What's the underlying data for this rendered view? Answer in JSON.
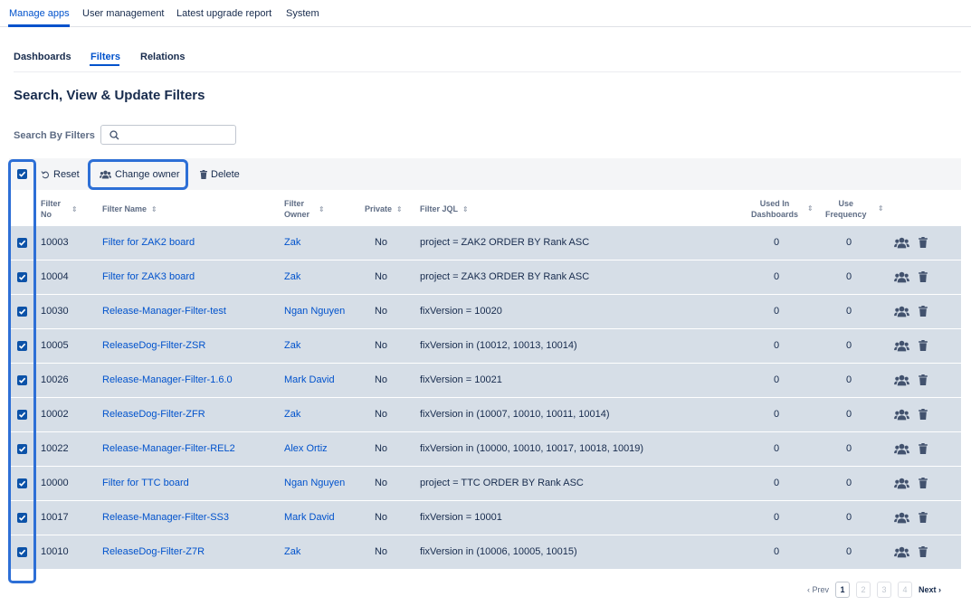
{
  "topnav": {
    "items": [
      "Manage apps",
      "User management",
      "Latest upgrade report",
      "System"
    ],
    "active": "Manage apps"
  },
  "subtabs": {
    "items": [
      "Dashboards",
      "Filters",
      "Relations"
    ],
    "active": "Filters"
  },
  "page_title": "Search, View & Update Filters",
  "search": {
    "label": "Search By Filters",
    "value": "",
    "icon": "search-icon"
  },
  "toolbar": {
    "select_all_checked": true,
    "reset_label": "Reset",
    "change_owner_label": "Change owner",
    "delete_label": "Delete"
  },
  "table": {
    "headers": {
      "filter_no": [
        "Filter",
        "No"
      ],
      "filter_name": "Filter Name",
      "filter_owner": [
        "Filter",
        "Owner"
      ],
      "private": "Private",
      "filter_jql": "Filter JQL",
      "used_in_dashboards": [
        "Used In",
        "Dashboards"
      ],
      "use_frequency": [
        "Use",
        "Frequency"
      ]
    },
    "rows": [
      {
        "no": "10003",
        "name": "Filter for ZAK2 board",
        "owner": "Zak",
        "private": "No",
        "jql": "project = ZAK2 ORDER BY Rank ASC",
        "used": "0",
        "freq": "0"
      },
      {
        "no": "10004",
        "name": "Filter for ZAK3 board",
        "owner": "Zak",
        "private": "No",
        "jql": "project = ZAK3 ORDER BY Rank ASC",
        "used": "0",
        "freq": "0"
      },
      {
        "no": "10030",
        "name": "Release-Manager-Filter-test",
        "owner": "Ngan Nguyen",
        "private": "No",
        "jql": "fixVersion = 10020",
        "used": "0",
        "freq": "0"
      },
      {
        "no": "10005",
        "name": "ReleaseDog-Filter-ZSR",
        "owner": "Zak",
        "private": "No",
        "jql": "fixVersion in (10012, 10013, 10014)",
        "used": "0",
        "freq": "0"
      },
      {
        "no": "10026",
        "name": "Release-Manager-Filter-1.6.0",
        "owner": "Mark David",
        "private": "No",
        "jql": "fixVersion = 10021",
        "used": "0",
        "freq": "0"
      },
      {
        "no": "10002",
        "name": "ReleaseDog-Filter-ZFR",
        "owner": "Zak",
        "private": "No",
        "jql": "fixVersion in (10007, 10010, 10011, 10014)",
        "used": "0",
        "freq": "0"
      },
      {
        "no": "10022",
        "name": "Release-Manager-Filter-REL2",
        "owner": "Alex Ortiz",
        "private": "No",
        "jql": "fixVersion in (10000, 10010, 10017, 10018, 10019)",
        "used": "0",
        "freq": "0"
      },
      {
        "no": "10000",
        "name": "Filter for TTC board",
        "owner": "Ngan Nguyen",
        "private": "No",
        "jql": "project = TTC ORDER BY Rank ASC",
        "used": "0",
        "freq": "0"
      },
      {
        "no": "10017",
        "name": "Release-Manager-Filter-SS3",
        "owner": "Mark David",
        "private": "No",
        "jql": "fixVersion = 10001",
        "used": "0",
        "freq": "0"
      },
      {
        "no": "10010",
        "name": "ReleaseDog-Filter-Z7R",
        "owner": "Zak",
        "private": "No",
        "jql": "fixVersion in (10006, 10005, 10015)",
        "used": "0",
        "freq": "0"
      }
    ]
  },
  "pagination": {
    "prev_label": "Prev",
    "pages": [
      "1",
      "2",
      "3",
      "4"
    ],
    "current": "1",
    "next_label": "Next"
  },
  "colors": {
    "accent": "#0052cc",
    "row_selected_bg": "#d6dee7",
    "highlight_border": "#2d6fd6"
  }
}
